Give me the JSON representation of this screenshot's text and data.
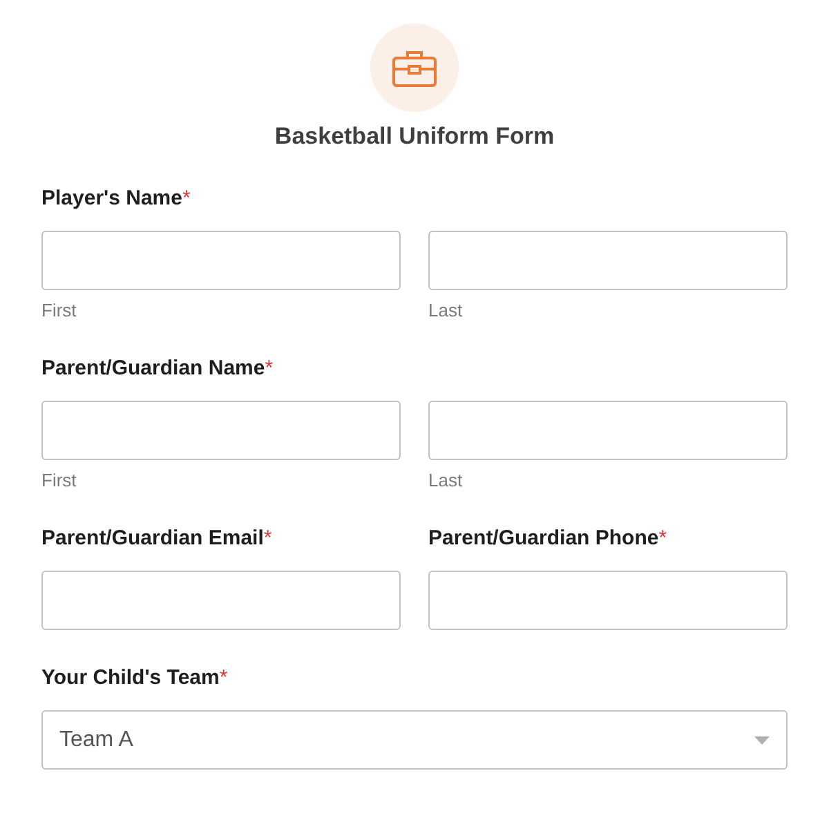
{
  "form": {
    "title": "Basketball Uniform Form",
    "required_mark": "*"
  },
  "sections": [
    {
      "kind": "name",
      "label": "Player's Name",
      "required": true,
      "subfields": [
        {
          "sublabel": "First"
        },
        {
          "sublabel": "Last"
        }
      ]
    },
    {
      "kind": "name",
      "label": "Parent/Guardian Name",
      "required": true,
      "subfields": [
        {
          "sublabel": "First"
        },
        {
          "sublabel": "Last"
        }
      ]
    },
    {
      "kind": "pair",
      "fields": [
        {
          "label": "Parent/Guardian Email",
          "required": true
        },
        {
          "label": "Parent/Guardian Phone",
          "required": true
        }
      ]
    },
    {
      "kind": "select",
      "label": "Your Child's Team",
      "required": true,
      "value": "Team A"
    }
  ]
}
